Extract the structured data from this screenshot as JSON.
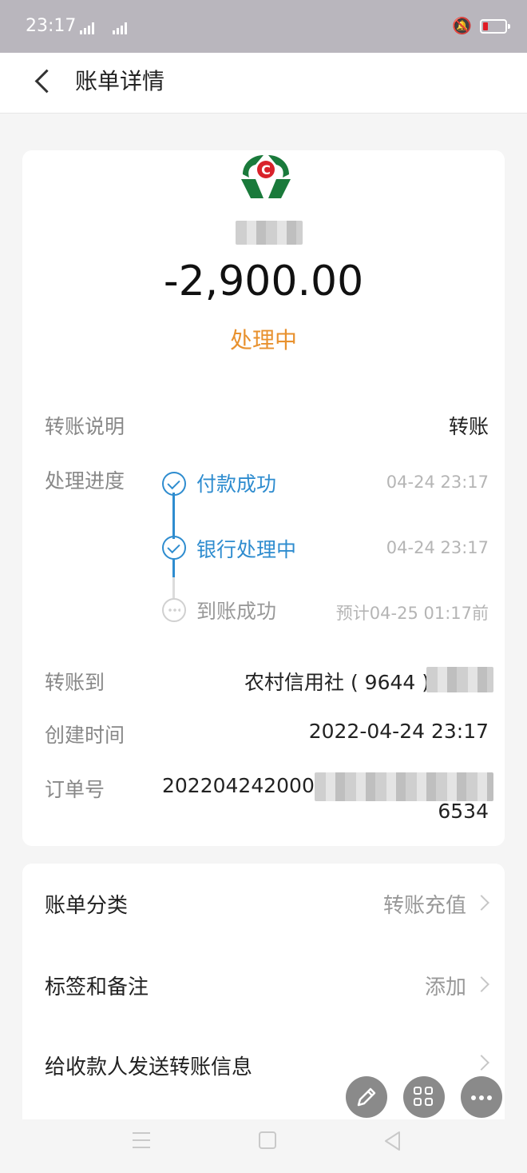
{
  "status_bar": {
    "time": "23:17",
    "battery_color": "#e01b24"
  },
  "nav": {
    "title": "账单详情"
  },
  "bill": {
    "amount": "-2,900.00",
    "status": "处理中",
    "status_color": "#e8912e"
  },
  "details": {
    "transfer_note_label": "转账说明",
    "transfer_note_value": "转账",
    "progress_label": "处理进度",
    "steps": [
      {
        "label": "付款成功",
        "time": "04-24 23:17"
      },
      {
        "label": "银行处理中",
        "time": "04-24 23:17"
      },
      {
        "label": "到账成功",
        "time": "预计04-25 01:17前"
      }
    ],
    "transfer_to_label": "转账到",
    "transfer_to_value": "农村信用社 ( 9644 )",
    "created_label": "创建时间",
    "created_value": "2022-04-24 23:17",
    "order_label": "订单号",
    "order_prefix": "2022042420004",
    "order_suffix": "6534"
  },
  "actions": {
    "category_label": "账单分类",
    "category_value": "转账充值",
    "tags_label": "标签和备注",
    "tags_value": "添加",
    "send_info_label": "给收款人发送转账信息"
  },
  "accent_color": "#2e8ccf"
}
